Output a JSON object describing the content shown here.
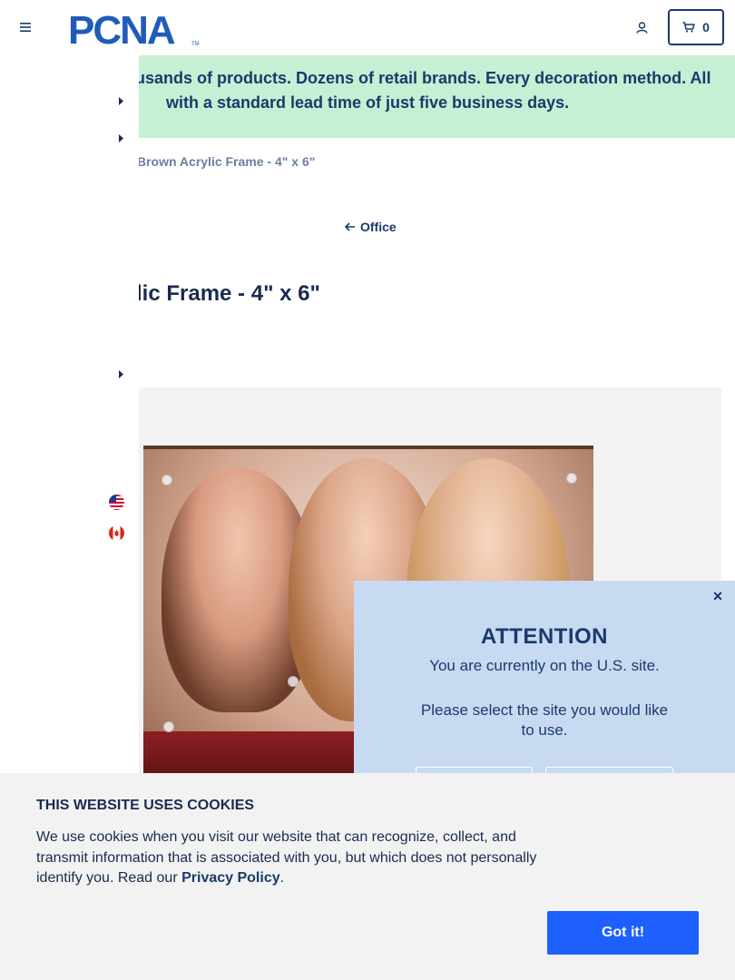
{
  "header": {
    "logo_text": "PCNA",
    "logo_tm": "TM",
    "cart_count": "0"
  },
  "banner": {
    "line1": "usands of products. Dozens of retail brands. Every decoration method. All",
    "line2": "with a standard lead time of just five business days."
  },
  "breadcrumb": {
    "current": "Brown Acrylic Frame - 4\" x 6\""
  },
  "back_link": {
    "label": "Office"
  },
  "product": {
    "title": "lic Frame - 4\" x 6\""
  },
  "site_modal": {
    "close": "×",
    "title": "ATTENTION",
    "message": "You are currently on the U.S. site.",
    "prompt": "Please select the site you would like to use."
  },
  "cookie_banner": {
    "title": "THIS WEBSITE USES COOKIES",
    "text_before": "We use cookies when you visit our website that can recognize, collect, and transmit information that is associated with you, but which does not personally identify you. Read our ",
    "link_label": "Privacy Policy",
    "text_after": ".",
    "accept_label": "Got it!"
  },
  "colors": {
    "brand_navy": "#1a3a6b",
    "banner_green": "#c6efd3",
    "modal_blue": "#c8daf2",
    "accept_blue": "#1d5fff"
  }
}
